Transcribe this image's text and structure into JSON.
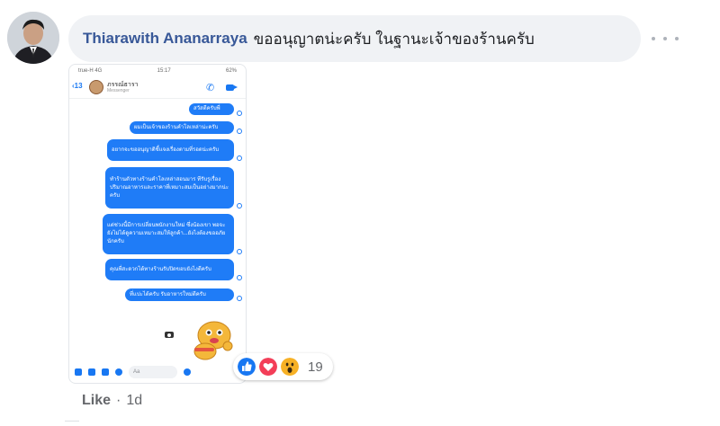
{
  "comment": {
    "author": "Thiarawith Ananarraya",
    "text": "ขออนุญาตน่ะครับ ในฐานะเจ้าของร้านครับ",
    "reaction_count": "19",
    "reaction_icons": [
      "like-icon",
      "love-icon",
      "wow-icon"
    ],
    "like_label": "Like",
    "separator": "·",
    "time": "1d"
  },
  "screenshot": {
    "status_left": "true-H 4G",
    "status_time": "15:17",
    "status_right": "62%",
    "back_count": "13",
    "contact_name": "ภรรณ์ธารา",
    "contact_sub": "Messenger",
    "messages": [
      "สวัสดีครับพี่",
      "ผมเป็นเจ้าของร้านคำโลเหล่าน่ะครับ",
      "อยากจะขออนุญาติชี้แจงเรื่องตามที่รอดน่ะครับ",
      "ทำร้านตัวทางร้านคำโลเหล่าสอนมาร ทีรับรูเรื่องปริมาณอาหารและราคาที่เหมาะสมเป็นอย่างมากน่ะครับ",
      "แต่ช่วงนี้มีการเปลี่ยนพนักงานใหม่ ซึ่งน้องเขา พอจะยังไม่ได้ดูความเหมาะสมให้ลูกค้า...ยังไงต้องขออภัยนักครับ",
      "คุณพี่สะดวกได้ทางร้านรับปิดขอบยังไงดีครับ",
      "ที่แปะได้ครับ รับอาหารใหม่ดีครับ"
    ],
    "composer_placeholder": "Aa"
  },
  "colors": {
    "author": "#385898",
    "bubble_bg": "#f0f2f5",
    "messenger_blue": "#1f7cf7",
    "muted": "#65676b"
  }
}
